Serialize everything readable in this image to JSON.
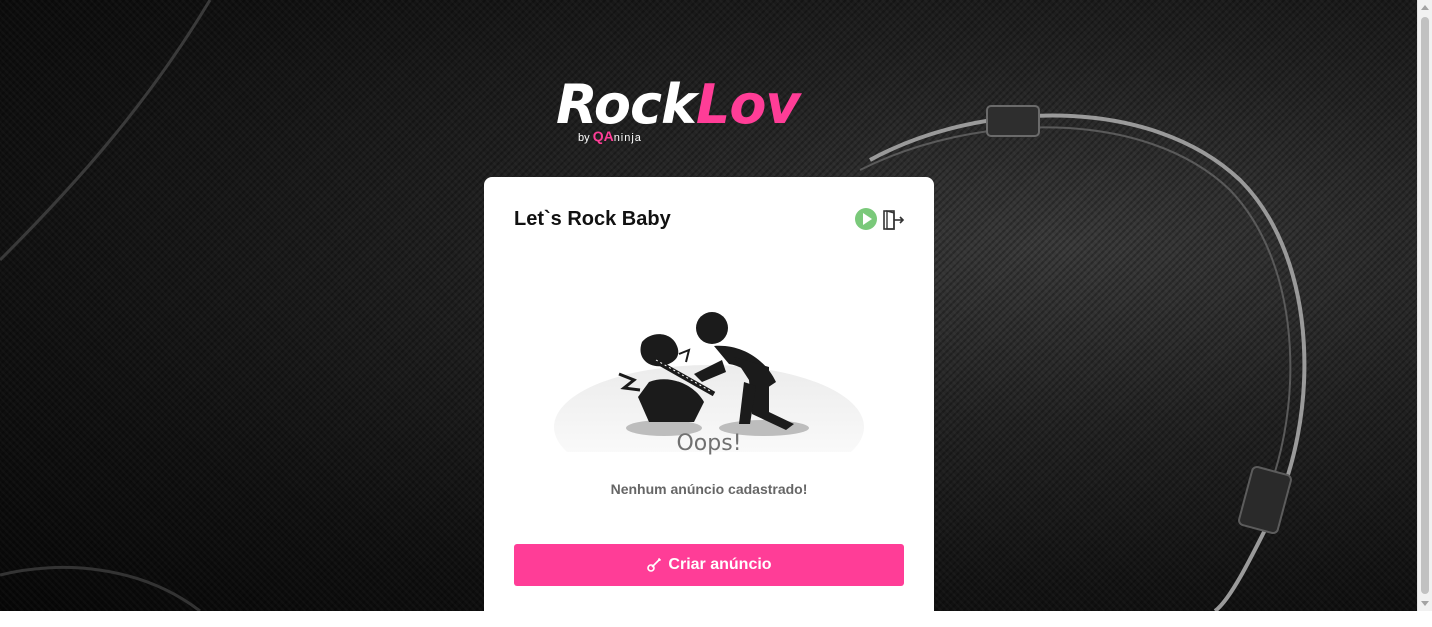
{
  "brand": {
    "logo_part1": "Rock",
    "logo_part2": "Lov",
    "byline_prefix": "by",
    "byline_qa": "QA",
    "byline_ninja": "ninja",
    "accent_color": "#ff3d97"
  },
  "card": {
    "title": "Let`s Rock Baby",
    "icons": [
      "play-icon",
      "logout-icon"
    ],
    "empty_state": {
      "illustration": "person-smashing-guitar",
      "heading": "Oops!",
      "message": "Nenhum anúncio cadastrado!"
    },
    "create_button_label": "Criar anúncio",
    "create_button_icon": "guitar-icon"
  }
}
